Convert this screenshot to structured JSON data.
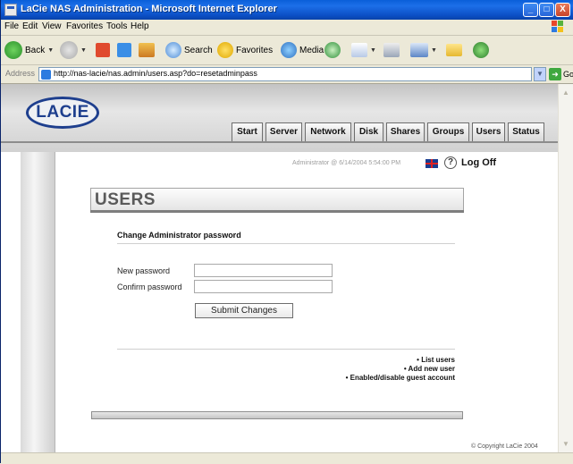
{
  "window": {
    "title": "LaCie NAS Administration - Microsoft Internet Explorer",
    "controls": {
      "minimize": "_",
      "maximize": "□",
      "close": "X"
    }
  },
  "menu": [
    "File",
    "Edit",
    "View",
    "Favorites",
    "Tools",
    "Help"
  ],
  "toolbar": {
    "back": "Back",
    "search": "Search",
    "favorites": "Favorites",
    "media": "Media"
  },
  "address": {
    "label": "Address",
    "url": "http://nas-lacie/nas.admin/users.asp?do=resetadminpass",
    "go": "Go"
  },
  "site": {
    "logo": "LACIE",
    "tabs": [
      "Start",
      "Server",
      "Network",
      "Disk",
      "Shares",
      "Groups",
      "Users",
      "Status"
    ],
    "status_line": "Administrator @ 6/14/2004 5:54:00 PM",
    "logoff": "Log Off",
    "help_glyph": "?"
  },
  "page": {
    "section_title": "USERS",
    "form_heading": "Change Administrator password",
    "new_password_label": "New password",
    "confirm_password_label": "Confirm password",
    "new_password_value": "",
    "confirm_password_value": "",
    "submit_label": "Submit Changes",
    "links": [
      "• List users",
      "• Add new user",
      "• Enabled/disable guest account"
    ],
    "copyright": "© Copyright LaCie 2004"
  },
  "colors": {
    "titlebar": "#0b4ec4",
    "logo_blue": "#1e3f8e",
    "header_gray": "#d1d1d1"
  },
  "icons": [
    "back-icon",
    "forward-icon",
    "stop-icon",
    "refresh-icon",
    "home-icon",
    "search-icon",
    "favorites-icon",
    "media-icon",
    "history-icon",
    "mail-icon",
    "print-icon",
    "edit-icon",
    "folder-icon",
    "messenger-icon",
    "uk-flag-icon",
    "help-icon"
  ]
}
